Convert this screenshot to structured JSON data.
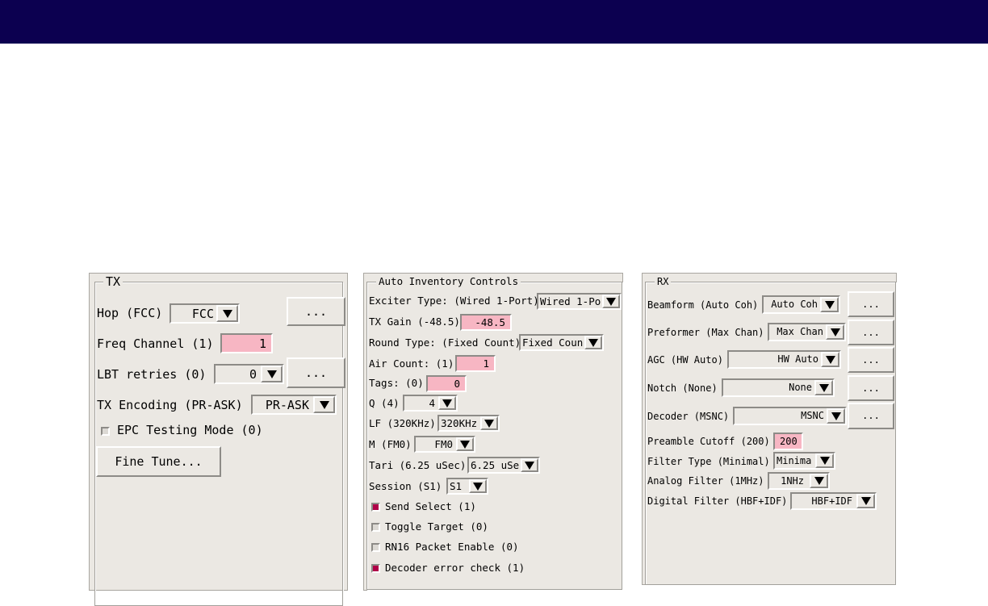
{
  "tx": {
    "title": "TX",
    "hop_label": "Hop (FCC)",
    "hop_value": "FCC",
    "hop_more": "...",
    "freq_label": "Freq Channel (1)",
    "freq_value": "1",
    "lbt_label": "LBT retries (0)",
    "lbt_value": "0",
    "lbt_more": "...",
    "enc_label": "TX Encoding (PR-ASK)",
    "enc_value": "PR-ASK",
    "epc_label": "EPC Testing Mode (0)",
    "fine_tune": "Fine Tune..."
  },
  "auto": {
    "title": "Auto Inventory Controls",
    "exciter_label": "Exciter Type: (Wired 1-Port)",
    "exciter_value": "Wired 1-Por",
    "gain_label": "TX Gain (-48.5)",
    "gain_value": "-48.5",
    "round_label": "Round Type: (Fixed Count)",
    "round_value": "Fixed Coun",
    "air_label": "Air Count: (1)",
    "air_value": "1",
    "tags_label": "Tags: (0)",
    "tags_value": "0",
    "q_label": "Q (4)",
    "q_value": "4",
    "lf_label": "LF (320KHz)",
    "lf_value": "320KHz",
    "m_label": "M (FM0)",
    "m_value": "FM0",
    "tari_label": "Tari (6.25 uSec)",
    "tari_value": "6.25 uSe",
    "session_label": "Session (S1)",
    "session_value": "S1",
    "send_select": "Send Select (1)",
    "toggle_target": "Toggle Target (0)",
    "rn16": "RN16 Packet Enable (0)",
    "decoder_check": "Decoder error check (1)"
  },
  "rx": {
    "title": "RX",
    "beam_label": "Beamform (Auto Coh)",
    "beam_value": "Auto Coh",
    "pre_label": "Preformer (Max Chan)",
    "pre_value": "Max Chan",
    "agc_label": "AGC (HW Auto)",
    "agc_value": "HW Auto",
    "notch_label": "Notch (None)",
    "notch_value": "None",
    "dec_label": "Decoder (MSNC)",
    "dec_value": "MSNC",
    "more": "...",
    "pre_cut_label": "Preamble Cutoff (200)",
    "pre_cut_value": "200",
    "filter_label": "Filter Type (Minimal)",
    "filter_value": "Minima",
    "analog_label": "Analog Filter (1MHz)",
    "analog_value": "1NHz",
    "digital_label": "Digital Filter (HBF+IDF)",
    "digital_value": "HBF+IDF"
  },
  "colors": {
    "title_bar": "#0c0050",
    "panel_bg": "#ebe8e3",
    "field_pink": "#f7b6c3",
    "checked": "#b00048"
  }
}
